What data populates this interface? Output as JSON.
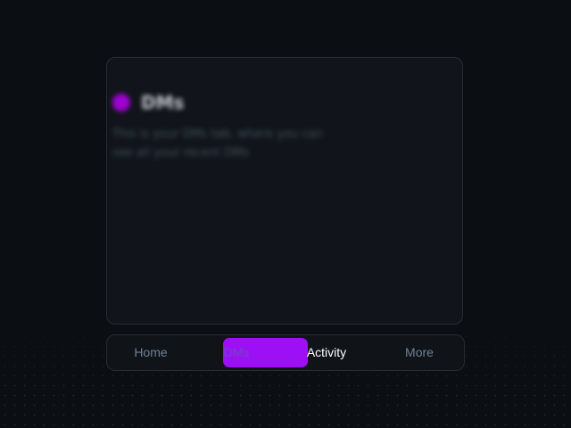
{
  "panel": {
    "title": "DMs",
    "description": "This is your DMs tab, where you can see all your recent DMs"
  },
  "tabbar": {
    "tabs": [
      {
        "id": "home",
        "label": "Home"
      },
      {
        "id": "dms",
        "label": "DMs"
      },
      {
        "id": "activity",
        "label": "Activity"
      },
      {
        "id": "more",
        "label": "More"
      }
    ]
  },
  "colors": {
    "background": "#0b0e12",
    "panel": "#11151b",
    "accent": "#9d0ff5",
    "dm_dot": "#b000e6",
    "active_tab_text": "#ffffff",
    "inactive_tab_text": "#6f8196"
  }
}
